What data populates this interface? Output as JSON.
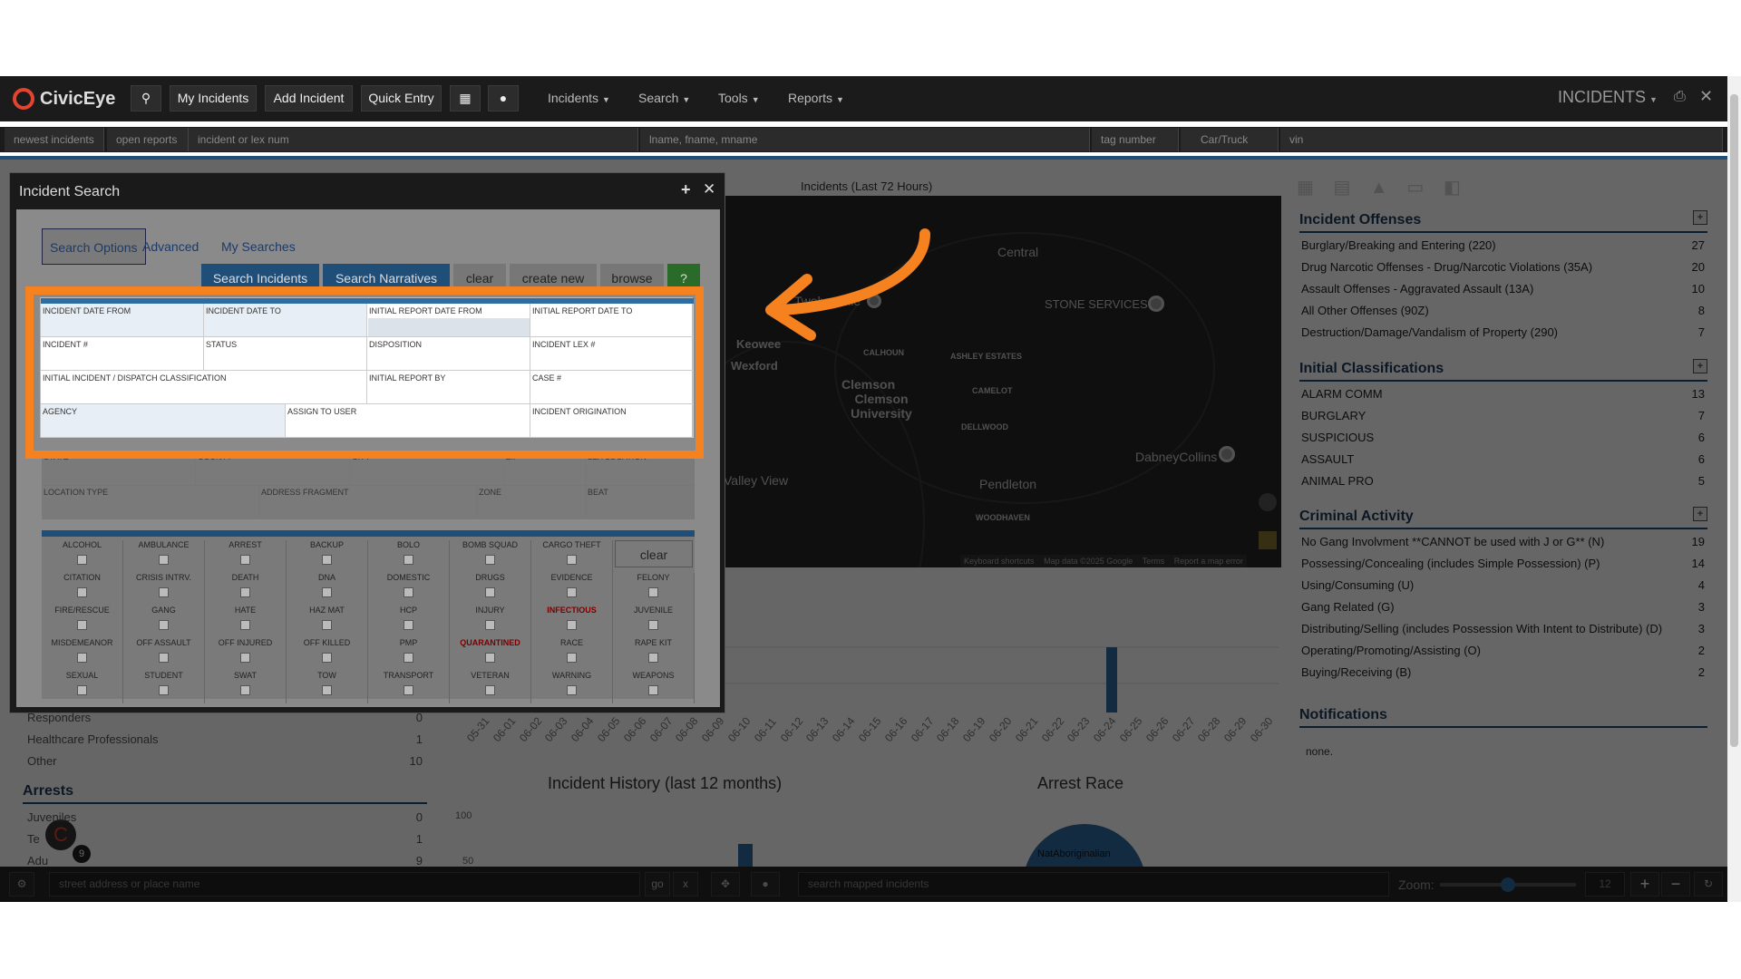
{
  "app": {
    "name": "CivicEye",
    "section": "INCIDENTS"
  },
  "toolbar": {
    "my_incidents": "My Incidents",
    "add_incident": "Add Incident",
    "quick_entry": "Quick Entry"
  },
  "nav": {
    "incidents": "Incidents",
    "search": "Search",
    "tools": "Tools",
    "reports": "Reports"
  },
  "quickbar": {
    "newest": "newest incidents",
    "open": "open reports",
    "incident_ph": "incident or lex num",
    "name_ph": "lname, fname, mname",
    "tag_ph": "tag number",
    "vehicle": "Car/Truck",
    "vin_ph": "vin"
  },
  "map": {
    "title": "Incidents (Last 72 Hours)",
    "labels": [
      "Central",
      "Twelve Mile",
      "STONE SERVICES",
      "Keowee",
      "Wexford",
      "CALHOUN",
      "ASHLEY ESTATES",
      "CAMELOT",
      "Clemson",
      "Clemson University",
      "DELLWOOD",
      "DabneyCollins",
      "Valley View",
      "Pendleton",
      "WOODHAVEN"
    ],
    "footer": [
      "Keyboard shortcuts",
      "Map data ©2025 Google",
      "Terms",
      "Report a map error"
    ]
  },
  "right": {
    "offenses": {
      "title": "Incident Offenses",
      "rows": [
        {
          "l": "Burglary/Breaking and Entering (220)",
          "c": "27"
        },
        {
          "l": "Drug Narcotic Offenses - Drug/Narcotic Violations (35A)",
          "c": "20"
        },
        {
          "l": "Assault Offenses - Aggravated Assault (13A)",
          "c": "10"
        },
        {
          "l": "All Other Offenses (90Z)",
          "c": "8"
        },
        {
          "l": "Destruction/Damage/Vandalism of Property (290)",
          "c": "7"
        }
      ]
    },
    "classifications": {
      "title": "Initial Classifications",
      "rows": [
        {
          "l": "ALARM COMM",
          "c": "13"
        },
        {
          "l": "BURGLARY",
          "c": "7"
        },
        {
          "l": "SUSPICIOUS",
          "c": "6"
        },
        {
          "l": "ASSAULT",
          "c": "6"
        },
        {
          "l": "ANIMAL PRO",
          "c": "5"
        }
      ]
    },
    "criminal": {
      "title": "Criminal Activity",
      "rows": [
        {
          "l": "No Gang Involvment **CANNOT be used with J or G** (N)",
          "c": "19"
        },
        {
          "l": "Possessing/Concealing (includes Simple Possession) (P)",
          "c": "14"
        },
        {
          "l": "Using/Consuming (U)",
          "c": "4"
        },
        {
          "l": "Gang Related (G)",
          "c": "3"
        },
        {
          "l": "Distributing/Selling (includes Possession With Intent to Distribute) (D)",
          "c": "3"
        },
        {
          "l": "Operating/Promoting/Assisting (O)",
          "c": "2"
        },
        {
          "l": "Buying/Receiving (B)",
          "c": "2"
        }
      ]
    },
    "notifications": {
      "title": "Notifications",
      "none": "none."
    }
  },
  "left": {
    "rows": [
      {
        "l": "Responders",
        "c": "0"
      },
      {
        "l": "Healthcare Professionals",
        "c": "1"
      },
      {
        "l": "Other",
        "c": "10"
      }
    ],
    "arrests_title": "Arrests",
    "arrests": [
      {
        "l": "Juveniles",
        "c": "0"
      },
      {
        "l": "Te",
        "c": "1"
      },
      {
        "l": "Adu",
        "c": "9"
      }
    ],
    "badge": "9"
  },
  "charts": {
    "history_title": "Incident History (last 12 months)",
    "race_title": "Arrest Race",
    "race_label": "NatAboriginalian",
    "y100": "100",
    "y50": "50",
    "dates": [
      "05-31",
      "06-01",
      "06-02",
      "06-03",
      "06-04",
      "06-05",
      "06-06",
      "06-07",
      "06-08",
      "06-09",
      "06-10",
      "06-11",
      "06-12",
      "06-13",
      "06-14",
      "06-15",
      "06-16",
      "06-17",
      "06-18",
      "06-19",
      "06-20",
      "06-21",
      "06-22",
      "06-23",
      "06-24",
      "06-25",
      "06-26",
      "06-27",
      "06-28",
      "06-29",
      "06-30"
    ]
  },
  "dialog": {
    "title": "Incident Search",
    "tabs": [
      "Search Options",
      "Advanced",
      "My Searches"
    ],
    "buttons": {
      "search_incidents": "Search Incidents",
      "search_narratives": "Search Narratives",
      "clear": "clear",
      "create_new": "create new",
      "browse": "browse",
      "help": "?"
    },
    "fields": {
      "f1": "INCIDENT DATE FROM",
      "f2": "INCIDENT DATE TO",
      "f3": "INITIAL REPORT DATE FROM",
      "f4": "INITIAL REPORT DATE TO",
      "f5": "INCIDENT #",
      "f6": "STATUS",
      "f7": "DISPOSITION",
      "f8": "INCIDENT LEX #",
      "f9": "INITIAL INCIDENT / DISPATCH CLASSIFICATION",
      "f10": "INITIAL REPORT BY",
      "f11": "CASE #",
      "f12": "AGENCY",
      "f13": "ASSIGN TO USER",
      "f14": "INCIDENT ORIGINATION"
    },
    "loc": {
      "state": "STATE",
      "county": "COUNTY",
      "city": "CITY",
      "zip": "ZIP",
      "lex": "LEX LOCATION",
      "ltype": "LOCATION TYPE",
      "frag": "ADDRESS FRAGMENT",
      "zone": "ZONE",
      "beat": "BEAT"
    },
    "flags": [
      [
        "ALCOHOL",
        "AMBULANCE",
        "ARREST",
        "BACKUP",
        "BOLO",
        "BOMB SQUAD",
        "CARGO THEFT"
      ],
      [
        "CITATION",
        "CRISIS INTRV.",
        "DEATH",
        "DNA",
        "DOMESTIC",
        "DRUGS",
        "EVIDENCE",
        "FELONY"
      ],
      [
        "FIRE/RESCUE",
        "GANG",
        "HATE",
        "HAZ MAT",
        "HCP",
        "INJURY",
        "INFECTIOUS",
        "JUVENILE"
      ],
      [
        "MISDEMEANOR",
        "OFF ASSAULT",
        "OFF INJURED",
        "OFF KILLED",
        "PMP",
        "QUARANTINED",
        "RACE",
        "RAPE KIT"
      ],
      [
        "SEXUAL",
        "STUDENT",
        "SWAT",
        "TOW",
        "TRANSPORT",
        "VETERAN",
        "WARNING",
        "WEAPONS"
      ]
    ],
    "flags_clear": "clear"
  },
  "bottom": {
    "addr_ph": "street address or place name",
    "go": "go",
    "x": "x",
    "search_ph": "search mapped incidents",
    "zoom_label": "Zoom:",
    "zoom": "12",
    "zoom_value": 0.5
  }
}
